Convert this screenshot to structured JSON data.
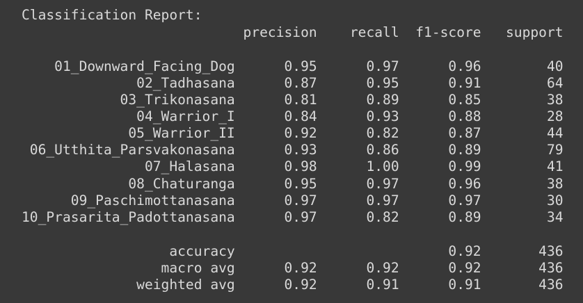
{
  "report": {
    "title": "Classification Report:",
    "headers": [
      "precision",
      "recall",
      "f1-score",
      "support"
    ],
    "rows": [
      {
        "label": "01_Downward_Facing_Dog",
        "precision": "0.95",
        "recall": "0.97",
        "f1": "0.96",
        "support": "40"
      },
      {
        "label": "02_Tadhasana",
        "precision": "0.87",
        "recall": "0.95",
        "f1": "0.91",
        "support": "64"
      },
      {
        "label": "03_Trikonasana",
        "precision": "0.81",
        "recall": "0.89",
        "f1": "0.85",
        "support": "38"
      },
      {
        "label": "04_Warrior_I",
        "precision": "0.84",
        "recall": "0.93",
        "f1": "0.88",
        "support": "28"
      },
      {
        "label": "05_Warrior_II",
        "precision": "0.92",
        "recall": "0.82",
        "f1": "0.87",
        "support": "44"
      },
      {
        "label": "06_Utthita_Parsvakonasana",
        "precision": "0.93",
        "recall": "0.86",
        "f1": "0.89",
        "support": "79"
      },
      {
        "label": "07_Halasana",
        "precision": "0.98",
        "recall": "1.00",
        "f1": "0.99",
        "support": "41"
      },
      {
        "label": "08_Chaturanga",
        "precision": "0.95",
        "recall": "0.97",
        "f1": "0.96",
        "support": "38"
      },
      {
        "label": "09_Paschimottanasana",
        "precision": "0.97",
        "recall": "0.97",
        "f1": "0.97",
        "support": "30"
      },
      {
        "label": "10_Prasarita_Padottanasana",
        "precision": "0.97",
        "recall": "0.82",
        "f1": "0.89",
        "support": "34"
      }
    ],
    "summary": [
      {
        "label": "accuracy",
        "precision": "",
        "recall": "",
        "f1": "0.92",
        "support": "436"
      },
      {
        "label": "macro avg",
        "precision": "0.92",
        "recall": "0.92",
        "f1": "0.92",
        "support": "436"
      },
      {
        "label": "weighted avg",
        "precision": "0.92",
        "recall": "0.91",
        "f1": "0.91",
        "support": "436"
      }
    ]
  }
}
